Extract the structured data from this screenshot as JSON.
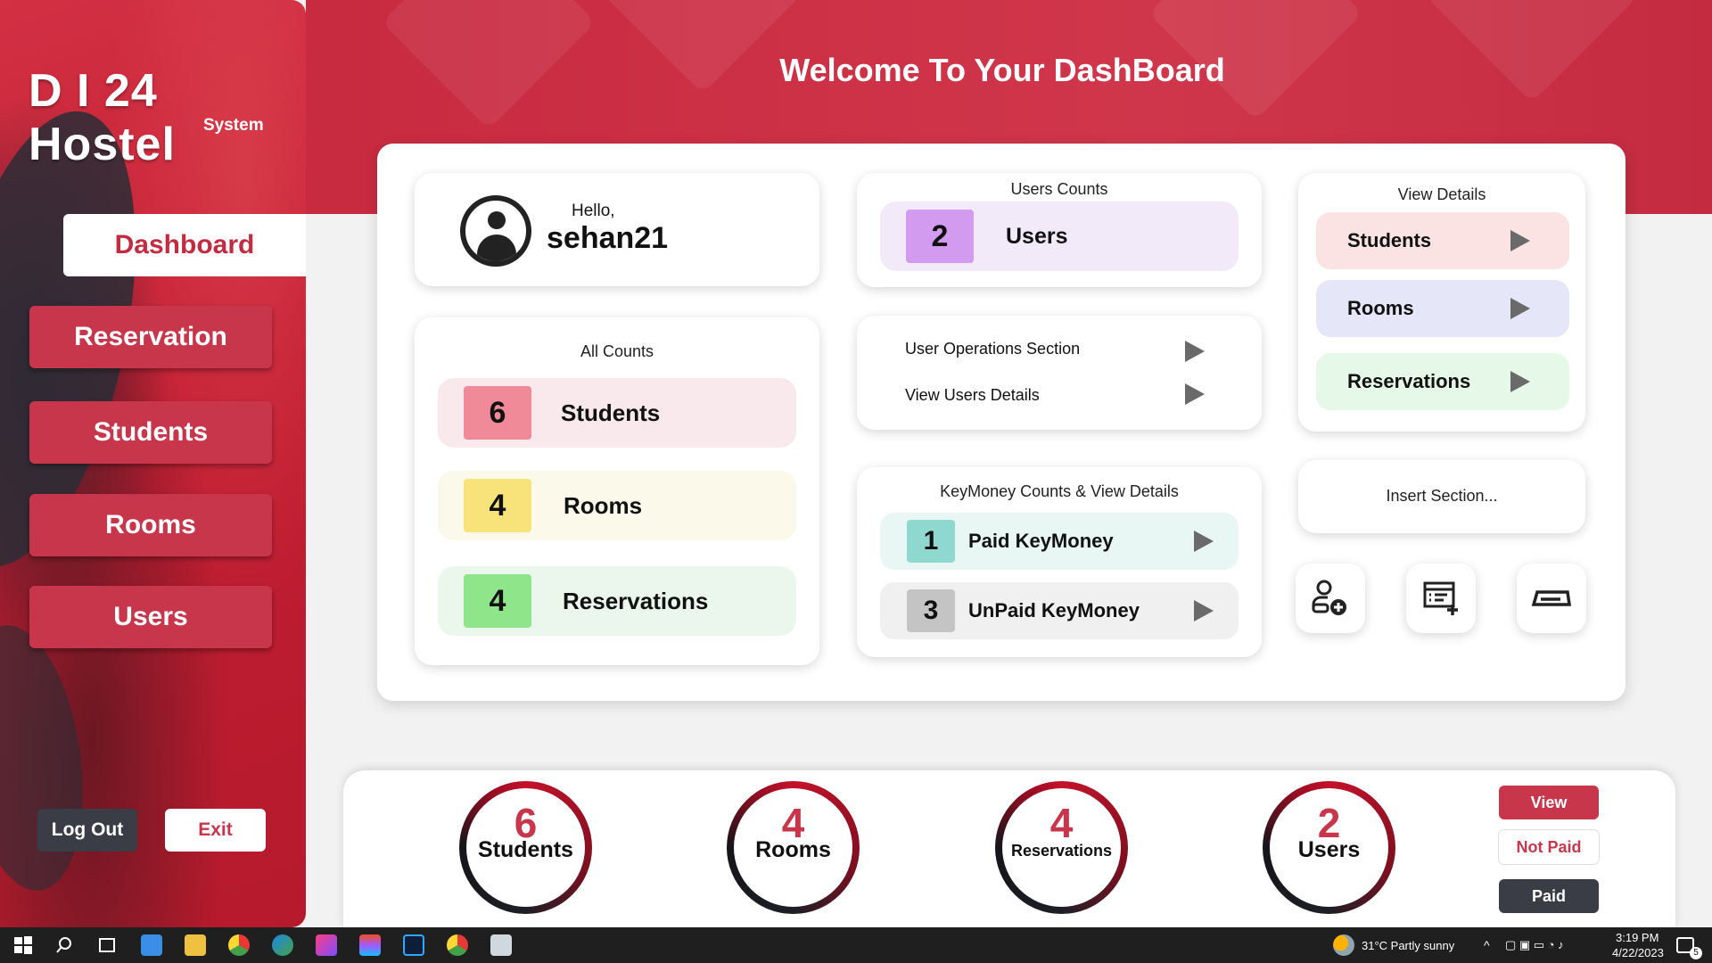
{
  "app": {
    "logo_title": "D I 24 Hostel",
    "logo_subtitle": "System",
    "welcome": "Welcome To Your DashBoard"
  },
  "sidebar": {
    "items": [
      {
        "label": "Dashboard",
        "active": true
      },
      {
        "label": "Reservation"
      },
      {
        "label": "Students"
      },
      {
        "label": "Rooms"
      },
      {
        "label": "Users"
      }
    ],
    "logout_label": "Log Out",
    "exit_label": "Exit"
  },
  "profile": {
    "greeting": "Hello,",
    "username": "sehan21"
  },
  "all_counts": {
    "title": "All Counts",
    "rows": [
      {
        "count": "6",
        "label": "Students",
        "color": "#f08a99",
        "bg": "#f9e9ec"
      },
      {
        "count": "4",
        "label": "Rooms",
        "color": "#f7e37a",
        "bg": "#fbf9ea"
      },
      {
        "count": "4",
        "label": "Reservations",
        "color": "#8ee58a",
        "bg": "#ebf7ec"
      }
    ]
  },
  "users_counts": {
    "title": "Users Counts",
    "count": "2",
    "label": "Users",
    "color": "#d39bf0",
    "bg": "#f2eaf8"
  },
  "user_operations": {
    "line1": "User Operations Section",
    "line2": "View Users Details"
  },
  "keymoney": {
    "title": "KeyMoney Counts & View Details",
    "rows": [
      {
        "count": "1",
        "label": "Paid KeyMoney",
        "color": "#8fd8cf",
        "bg": "#e8f6f4"
      },
      {
        "count": "3",
        "label": "UnPaid KeyMoney",
        "color": "#c4c4c4",
        "bg": "#f0f0f0"
      }
    ]
  },
  "view_details": {
    "title": "View Details",
    "rows": [
      {
        "label": "Students",
        "bg": "#fbe3e3"
      },
      {
        "label": "Rooms",
        "bg": "#e6e6f9"
      },
      {
        "label": "Reservations",
        "bg": "#e6f9e8"
      }
    ]
  },
  "insert_section": {
    "label": "Insert Section...",
    "icons": [
      "add-user-icon",
      "add-list-icon",
      "card-icon"
    ]
  },
  "summary": [
    {
      "count": "6",
      "label": "Students"
    },
    {
      "count": "4",
      "label": "Rooms"
    },
    {
      "count": "4",
      "label": "Reservations"
    },
    {
      "count": "2",
      "label": "Users"
    }
  ],
  "filters": {
    "view": "View",
    "not_paid": "Not Paid",
    "paid": "Paid"
  },
  "colors": {
    "accent": "#c8364b",
    "dark": "#3b3d46"
  },
  "taskbar": {
    "weather": "31°C  Partly sunny",
    "time": "3:19 PM",
    "date": "4/22/2023",
    "notifications": "5"
  }
}
